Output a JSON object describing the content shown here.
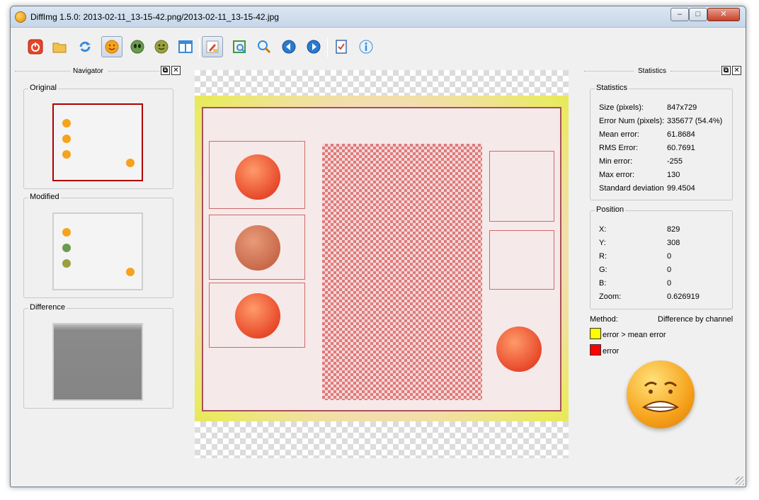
{
  "window": {
    "title": "DiffImg 1.5.0: 2013-02-11_13-15-42.png/2013-02-11_13-15-42.jpg",
    "controls": {
      "minimize": "–",
      "maximize": "□",
      "close": "✕"
    }
  },
  "toolbar": {
    "buttons": [
      {
        "name": "quit-button",
        "icon": "power-icon",
        "color": "#e8432a"
      },
      {
        "name": "open-button",
        "icon": "folder-icon",
        "color": "#f2c14e"
      },
      {
        "name": "refresh-button",
        "icon": "refresh-icon",
        "color": "#3a8ad8"
      },
      {
        "name": "show-original-button",
        "icon": "smiley-icon",
        "color": "#f6a21c",
        "active": true
      },
      {
        "name": "show-modified-button",
        "icon": "alien-icon",
        "color": "#6a9a50"
      },
      {
        "name": "show-difference-button",
        "icon": "alien-smiley-icon",
        "color": "#9aa040"
      },
      {
        "name": "dual-panel-button",
        "icon": "panel-icon",
        "color": "#3a8ad8"
      },
      {
        "name": "difference-mode-button",
        "icon": "brush-icon",
        "color": "#d04a30",
        "active": true
      },
      {
        "name": "fit-to-window-button",
        "icon": "fit-icon",
        "color": "#3a9a40"
      },
      {
        "name": "zoom-button",
        "icon": "zoom-icon",
        "color": "#3a8ad8"
      },
      {
        "name": "previous-button",
        "icon": "arrow-left-icon",
        "color": "#2a7ad0"
      },
      {
        "name": "next-button",
        "icon": "arrow-right-icon",
        "color": "#2a7ad0"
      },
      {
        "name": "settings-button",
        "icon": "checklist-icon",
        "color": "#3a6ab0"
      },
      {
        "name": "about-button",
        "icon": "info-icon",
        "color": "#3a8ad8"
      }
    ]
  },
  "navigator": {
    "title": "Navigator",
    "groups": [
      {
        "label": "Original"
      },
      {
        "label": "Modified"
      },
      {
        "label": "Difference"
      }
    ]
  },
  "statistics_dock": {
    "title": "Statistics",
    "stats_group": {
      "label": "Statistics",
      "rows": [
        {
          "key": "Size (pixels):",
          "value": "847x729"
        },
        {
          "key": "Error Num (pixels):",
          "value": "335677 (54.4%)"
        },
        {
          "key": "Mean error:",
          "value": "61.8684"
        },
        {
          "key": "RMS Error:",
          "value": "60.7691"
        },
        {
          "key": "Min error:",
          "value": "-255"
        },
        {
          "key": "Max error:",
          "value": "130"
        },
        {
          "key": "Standard deviation",
          "value": "99.4504"
        }
      ]
    },
    "position_group": {
      "label": "Position",
      "rows": [
        {
          "key": "X:",
          "value": "829"
        },
        {
          "key": "Y:",
          "value": "308"
        },
        {
          "key": "R:",
          "value": "0"
        },
        {
          "key": "G:",
          "value": "0"
        },
        {
          "key": "B:",
          "value": "0"
        },
        {
          "key": "Zoom:",
          "value": "0.626919"
        }
      ]
    },
    "method": {
      "label": "Method:",
      "value": "Difference by channel"
    },
    "legend": [
      {
        "label": "error > mean error",
        "color": "#ffff00"
      },
      {
        "label": "error",
        "color": "#ff0000"
      }
    ]
  },
  "colors": {
    "window_bg": "#f0f0f0",
    "selected_thumb_border": "#b00000",
    "diff_red": "#e07a7a"
  }
}
